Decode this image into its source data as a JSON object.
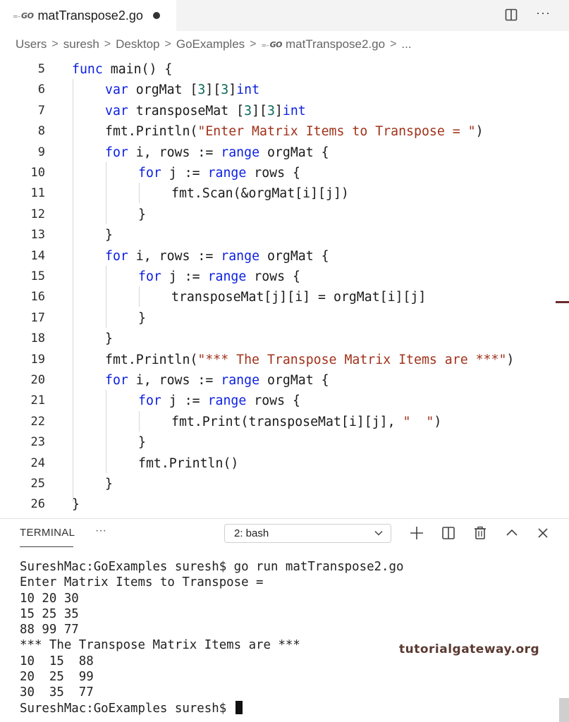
{
  "tab": {
    "badge": "GO",
    "title": "matTranspose2.go"
  },
  "breadcrumb": {
    "items": [
      "Users",
      "suresh",
      "Desktop",
      "GoExamples"
    ],
    "file": "matTranspose2.go",
    "ellipsis": "...",
    "separator": ">"
  },
  "editor": {
    "lines": [
      {
        "n": "5",
        "indent": 0,
        "tokens": [
          [
            "kw",
            "func"
          ],
          [
            "t",
            " main() {"
          ]
        ]
      },
      {
        "n": "6",
        "indent": 1,
        "tokens": [
          [
            "kw",
            "var"
          ],
          [
            "t",
            " orgMat ["
          ],
          [
            "num",
            "3"
          ],
          [
            "t",
            "]["
          ],
          [
            "num",
            "3"
          ],
          [
            "t",
            "]"
          ],
          [
            "kw",
            "int"
          ]
        ]
      },
      {
        "n": "7",
        "indent": 1,
        "tokens": [
          [
            "kw",
            "var"
          ],
          [
            "t",
            " transposeMat ["
          ],
          [
            "num",
            "3"
          ],
          [
            "t",
            "]["
          ],
          [
            "num",
            "3"
          ],
          [
            "t",
            "]"
          ],
          [
            "kw",
            "int"
          ]
        ]
      },
      {
        "n": "8",
        "indent": 1,
        "tokens": [
          [
            "t",
            "fmt.Println("
          ],
          [
            "str",
            "\"Enter Matrix Items to Transpose = \""
          ],
          [
            "t",
            ")"
          ]
        ]
      },
      {
        "n": "9",
        "indent": 1,
        "tokens": [
          [
            "kw",
            "for"
          ],
          [
            "t",
            " i, rows := "
          ],
          [
            "kw",
            "range"
          ],
          [
            "t",
            " orgMat {"
          ]
        ]
      },
      {
        "n": "10",
        "indent": 2,
        "tokens": [
          [
            "kw",
            "for"
          ],
          [
            "t",
            " j := "
          ],
          [
            "kw",
            "range"
          ],
          [
            "t",
            " rows {"
          ]
        ]
      },
      {
        "n": "11",
        "indent": 3,
        "tokens": [
          [
            "t",
            "fmt.Scan(&orgMat[i][j])"
          ]
        ]
      },
      {
        "n": "12",
        "indent": 2,
        "tokens": [
          [
            "t",
            "}"
          ]
        ]
      },
      {
        "n": "13",
        "indent": 1,
        "tokens": [
          [
            "t",
            "}"
          ]
        ]
      },
      {
        "n": "14",
        "indent": 1,
        "tokens": [
          [
            "kw",
            "for"
          ],
          [
            "t",
            " i, rows := "
          ],
          [
            "kw",
            "range"
          ],
          [
            "t",
            " orgMat {"
          ]
        ]
      },
      {
        "n": "15",
        "indent": 2,
        "tokens": [
          [
            "kw",
            "for"
          ],
          [
            "t",
            " j := "
          ],
          [
            "kw",
            "range"
          ],
          [
            "t",
            " rows {"
          ]
        ]
      },
      {
        "n": "16",
        "indent": 3,
        "tokens": [
          [
            "t",
            "transposeMat[j][i] = orgMat[i][j]"
          ]
        ]
      },
      {
        "n": "17",
        "indent": 2,
        "tokens": [
          [
            "t",
            "}"
          ]
        ]
      },
      {
        "n": "18",
        "indent": 1,
        "tokens": [
          [
            "t",
            "}"
          ]
        ]
      },
      {
        "n": "19",
        "indent": 1,
        "tokens": [
          [
            "t",
            "fmt.Println("
          ],
          [
            "str",
            "\"*** The Transpose Matrix Items are ***\""
          ],
          [
            "t",
            ")"
          ]
        ]
      },
      {
        "n": "20",
        "indent": 1,
        "tokens": [
          [
            "kw",
            "for"
          ],
          [
            "t",
            " i, rows := "
          ],
          [
            "kw",
            "range"
          ],
          [
            "t",
            " orgMat {"
          ]
        ]
      },
      {
        "n": "21",
        "indent": 2,
        "tokens": [
          [
            "kw",
            "for"
          ],
          [
            "t",
            " j := "
          ],
          [
            "kw",
            "range"
          ],
          [
            "t",
            " rows {"
          ]
        ]
      },
      {
        "n": "22",
        "indent": 3,
        "tokens": [
          [
            "t",
            "fmt.Print(transposeMat[i][j], "
          ],
          [
            "str",
            "\"  \""
          ],
          [
            "t",
            ")"
          ]
        ]
      },
      {
        "n": "23",
        "indent": 2,
        "tokens": [
          [
            "t",
            "}"
          ]
        ]
      },
      {
        "n": "24",
        "indent": 2,
        "tokens": [
          [
            "t",
            "fmt.Println()"
          ]
        ]
      },
      {
        "n": "25",
        "indent": 1,
        "tokens": [
          [
            "t",
            "}"
          ]
        ]
      },
      {
        "n": "26",
        "indent": 0,
        "tokens": [
          [
            "t",
            "}"
          ]
        ]
      }
    ]
  },
  "panel": {
    "title": "TERMINAL",
    "more": "···",
    "terminal_select": "2: bash"
  },
  "terminal": {
    "lines": [
      "SureshMac:GoExamples suresh$ go run matTranspose2.go",
      "Enter Matrix Items to Transpose =",
      "10 20 30",
      "15 25 35",
      "88 99 77",
      "*** The Transpose Matrix Items are ***",
      "10  15  88",
      "20  25  99",
      "30  35  77"
    ],
    "prompt": "SureshMac:GoExamples suresh$ "
  },
  "watermark": "tutorialgateway.org",
  "colors": {
    "keyword": "#0b1fe0",
    "number": "#0a6a5a",
    "string": "#a0321a"
  }
}
